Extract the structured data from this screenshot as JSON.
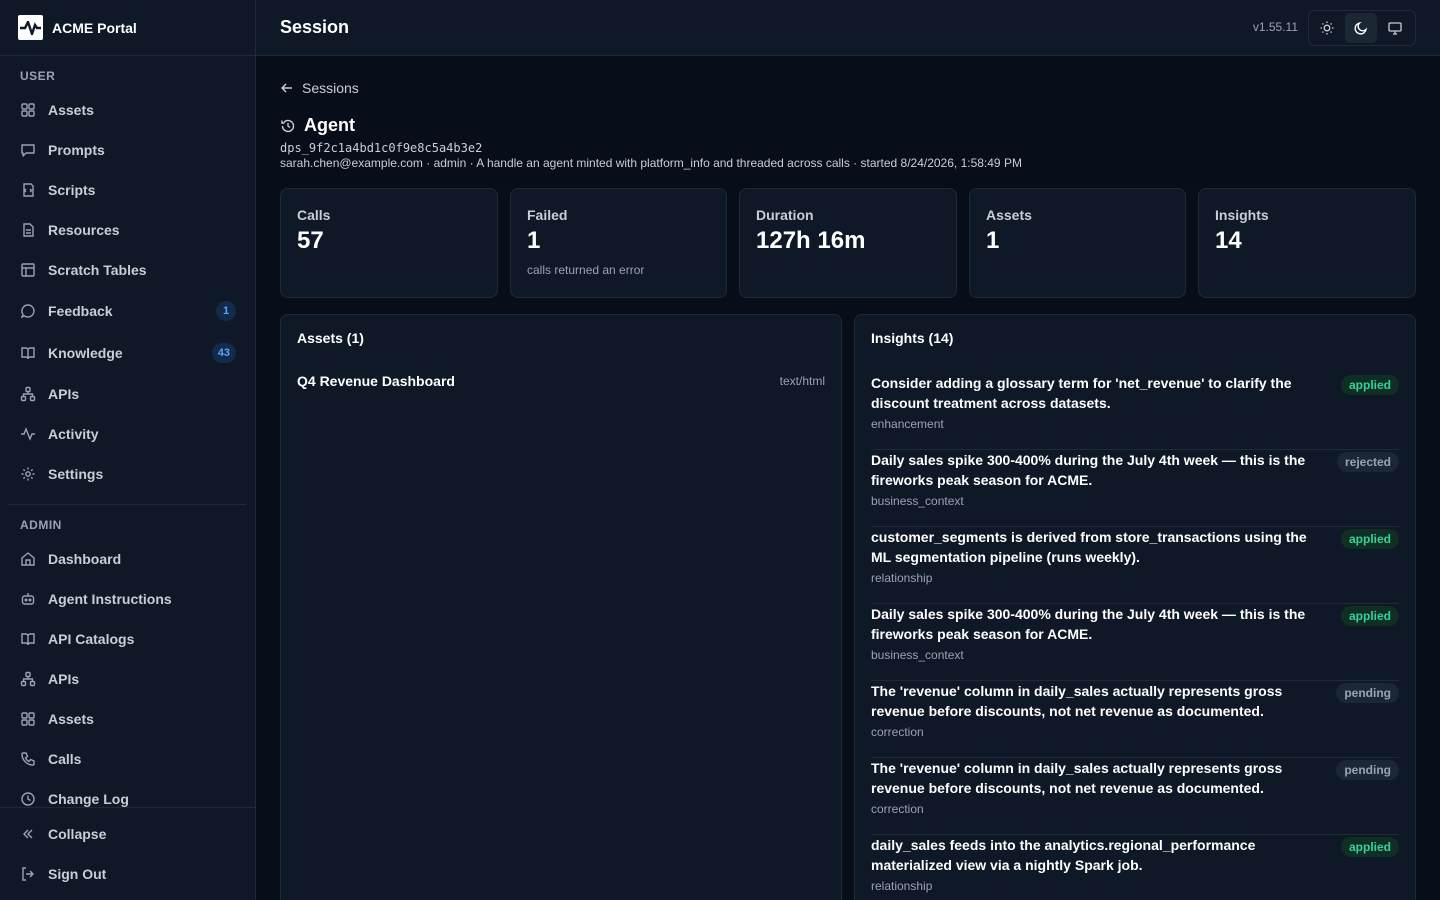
{
  "app": {
    "name": "ACME Portal"
  },
  "sidebar": {
    "user_label": "USER",
    "user_items": [
      {
        "label": "Assets",
        "icon": "grid-icon"
      },
      {
        "label": "Prompts",
        "icon": "chat-icon"
      },
      {
        "label": "Scripts",
        "icon": "script-icon"
      },
      {
        "label": "Resources",
        "icon": "file-icon"
      },
      {
        "label": "Scratch Tables",
        "icon": "table-icon"
      },
      {
        "label": "Feedback",
        "icon": "chat-icon",
        "badge": "1"
      },
      {
        "label": "Knowledge",
        "icon": "book-icon",
        "badge": "43"
      },
      {
        "label": "APIs",
        "icon": "network-icon"
      },
      {
        "label": "Activity",
        "icon": "activity-icon"
      },
      {
        "label": "Settings",
        "icon": "gear-icon"
      }
    ],
    "admin_label": "ADMIN",
    "admin_items": [
      {
        "label": "Dashboard",
        "icon": "home-icon"
      },
      {
        "label": "Agent Instructions",
        "icon": "bot-icon"
      },
      {
        "label": "API Catalogs",
        "icon": "book-icon"
      },
      {
        "label": "APIs",
        "icon": "network-icon"
      },
      {
        "label": "Assets",
        "icon": "grid-icon"
      },
      {
        "label": "Calls",
        "icon": "phone-icon"
      },
      {
        "label": "Change Log",
        "icon": "clock-icon"
      }
    ],
    "collapse_label": "Collapse",
    "signout_label": "Sign Out"
  },
  "header": {
    "title": "Session",
    "version": "v1.55.11",
    "theme_active": "dark"
  },
  "session": {
    "back_label": "Sessions",
    "title": "Agent",
    "id": "dps_9f2c1a4bd1c0f9e8c5a4b3e2",
    "meta": "sarah.chen@example.com · admin · A handle an agent minted with platform_info and threaded across calls · started 8/24/2026, 1:58:49 PM"
  },
  "stats": [
    {
      "label": "Calls",
      "value": "57",
      "sub": ""
    },
    {
      "label": "Failed",
      "value": "1",
      "sub": "calls returned an error"
    },
    {
      "label": "Duration",
      "value": "127h 16m",
      "sub": ""
    },
    {
      "label": "Assets",
      "value": "1",
      "sub": ""
    },
    {
      "label": "Insights",
      "value": "14",
      "sub": ""
    }
  ],
  "assets_panel": {
    "title": "Assets (1)",
    "items": [
      {
        "name": "Q4 Revenue Dashboard",
        "type": "text/html"
      }
    ]
  },
  "insights_panel": {
    "title": "Insights (14)",
    "items": [
      {
        "text": "Consider adding a glossary term for 'net_revenue' to clarify the discount treatment across datasets.",
        "category": "enhancement",
        "status": "applied"
      },
      {
        "text": "Daily sales spike 300-400% during the July 4th week — this is the fireworks peak season for ACME.",
        "category": "business_context",
        "status": "rejected"
      },
      {
        "text": "customer_segments is derived from store_transactions using the ML segmentation pipeline (runs weekly).",
        "category": "relationship",
        "status": "applied"
      },
      {
        "text": "Daily sales spike 300-400% during the July 4th week — this is the fireworks peak season for ACME.",
        "category": "business_context",
        "status": "applied"
      },
      {
        "text": "The 'revenue' column in daily_sales actually represents gross revenue before discounts, not net revenue as documented.",
        "category": "correction",
        "status": "pending"
      },
      {
        "text": "The 'revenue' column in daily_sales actually represents gross revenue before discounts, not net revenue as documented.",
        "category": "correction",
        "status": "pending"
      },
      {
        "text": "daily_sales feeds into the analytics.regional_performance materialized view via a nightly Spark job.",
        "category": "relationship",
        "status": "applied"
      }
    ]
  }
}
